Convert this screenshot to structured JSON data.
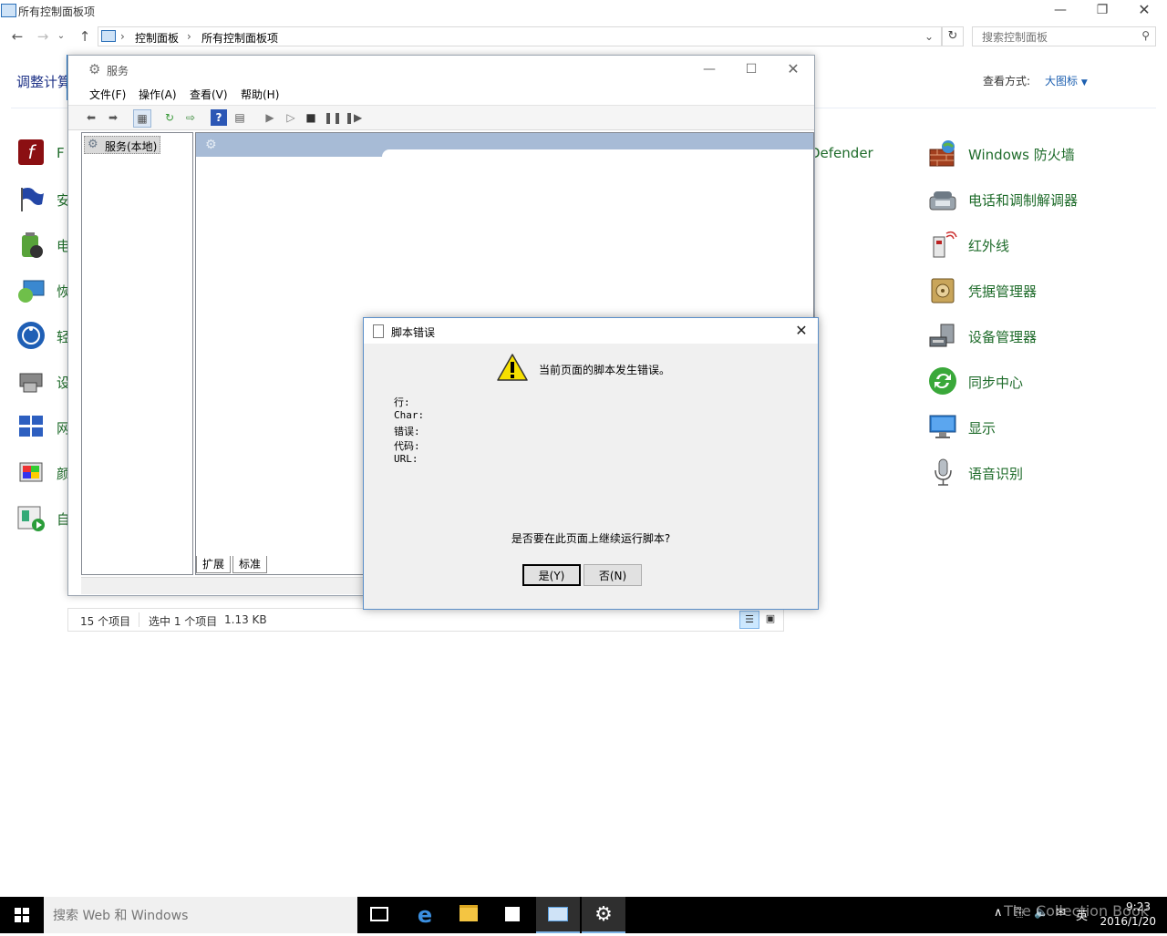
{
  "control_panel": {
    "title": "所有控制面板项",
    "address": {
      "root": "控制面板",
      "current": "所有控制面板项"
    },
    "search_placeholder": "搜索控制面板",
    "heading": "调整计算",
    "view_label": "查看方式:",
    "view_value": "大图标",
    "left_items": [
      {
        "label": "F",
        "icon": "flash-icon"
      },
      {
        "label": "安",
        "icon": "flag-icon"
      },
      {
        "label": "电",
        "icon": "power-icon"
      },
      {
        "label": "恢",
        "icon": "recovery-icon"
      },
      {
        "label": "轻",
        "icon": "ease-of-access-icon"
      },
      {
        "label": "设",
        "icon": "default-programs-icon"
      },
      {
        "label": "网",
        "icon": "network-icon"
      },
      {
        "label": "颜",
        "icon": "color-icon"
      },
      {
        "label": "自",
        "icon": "autoplay-icon"
      }
    ],
    "partial_item": "Defender",
    "right_items": [
      {
        "label": "Windows 防火墙",
        "icon": "firewall-icon"
      },
      {
        "label": "电话和调制解调器",
        "icon": "phone-modem-icon"
      },
      {
        "label": "红外线",
        "icon": "infrared-icon"
      },
      {
        "label": "凭据管理器",
        "icon": "credential-manager-icon"
      },
      {
        "label": "设备管理器",
        "icon": "device-manager-icon"
      },
      {
        "label": "同步中心",
        "icon": "sync-center-icon"
      },
      {
        "label": "显示",
        "icon": "display-icon"
      },
      {
        "label": "语音识别",
        "icon": "microphone-icon"
      }
    ],
    "status": {
      "count": "15 个项目",
      "selection": "选中 1 个项目",
      "size": "1.13 KB"
    }
  },
  "services": {
    "title": "服务",
    "menu": [
      "文件(F)",
      "操作(A)",
      "查看(V)",
      "帮助(H)"
    ],
    "tree_node": "服务(本地)",
    "tabs": [
      "扩展",
      "标准"
    ]
  },
  "script_error": {
    "title": "脚本错误",
    "headline": "当前页面的脚本发生错误。",
    "details": [
      "行:",
      "Char:",
      "错误:",
      "代码:",
      "URL:"
    ],
    "question": "是否要在此页面上继续运行脚本?",
    "yes_label": "是(Y)",
    "no_label": "否(N)"
  },
  "taskbar": {
    "search_placeholder": "搜索 Web 和 Windows",
    "time": "9:23",
    "date": "2016/1/20",
    "ime": "英",
    "watermark": "The Collection Book"
  },
  "colors": {
    "link_green": "#1e6b2a",
    "heading_blue": "#1e3287",
    "pane_header": "#a7bbd6"
  }
}
